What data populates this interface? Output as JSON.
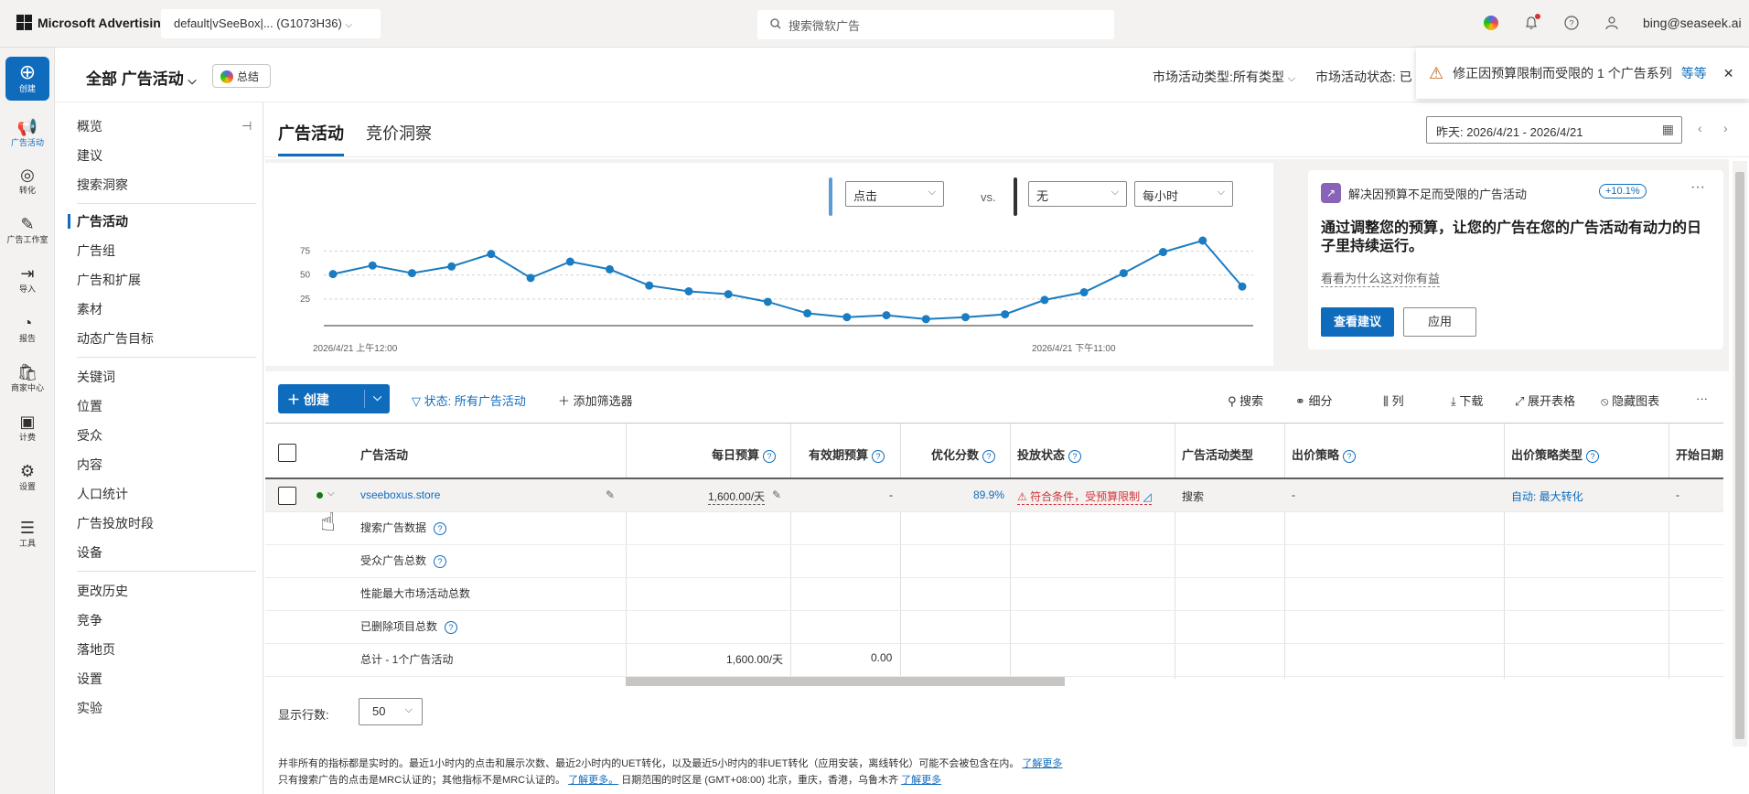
{
  "topbar": {
    "brand": "Microsoft Advertising",
    "account": "default|vSeeBox|...  (G1073H36)",
    "search_placeholder": "搜索微软广告",
    "user_email": "bing@seaseek.ai",
    "icons": [
      "copilot-icon",
      "bell-icon",
      "help-icon",
      "user-icon"
    ]
  },
  "rail": {
    "create": "创建",
    "items": [
      {
        "label": "广告活动",
        "icon": "megaphone-icon"
      },
      {
        "label": "转化",
        "icon": "target-icon"
      },
      {
        "label": "广告工作室",
        "icon": "pen-icon"
      },
      {
        "label": "导入",
        "icon": "import-icon"
      },
      {
        "label": "报告",
        "icon": "chart-icon"
      },
      {
        "label": "商家中心",
        "icon": "bag-icon"
      },
      {
        "label": "计费",
        "icon": "wallet-icon"
      },
      {
        "label": "设置",
        "icon": "gear-icon"
      },
      {
        "label": "工具",
        "icon": "tools-icon"
      }
    ]
  },
  "header": {
    "title": "全部 广告活动",
    "summary_btn": "总结",
    "filter_type": "市场活动类型:所有类型",
    "filter_status": "市场活动状态: 已"
  },
  "notice": {
    "text": "修正因预算限制而受限的 1 个广告系列",
    "more": "等等"
  },
  "subnav": {
    "group1": [
      "概览",
      "建议",
      "搜索洞察"
    ],
    "group2": [
      "广告活动",
      "广告组",
      "广告和扩展",
      "素材",
      "动态广告目标"
    ],
    "group3": [
      "关键词",
      "位置",
      "受众",
      "内容",
      "人口统计",
      "广告投放时段",
      "设备"
    ],
    "group4": [
      "更改历史",
      "竞争",
      "落地页",
      "设置",
      "实验"
    ]
  },
  "tabs": {
    "campaigns": "广告活动",
    "auction": "竞价洞察",
    "date_range": "昨天: 2026/4/21 - 2026/4/21"
  },
  "chart": {
    "metric1": "点击",
    "vs": "vs.",
    "metric2": "无",
    "granularity": "每小时",
    "colors": {
      "line": "#1a7cc1",
      "grid": "#d2d0ce"
    }
  },
  "chart_data": {
    "type": "line",
    "x_start_label": "2026/4/21 上午12:00",
    "x_end_label": "2026/4/21 下午11:00",
    "y_ticks": [
      25,
      50,
      75
    ],
    "ylim": [
      0,
      100
    ],
    "series": [
      {
        "values": [
          51,
          60,
          52,
          59,
          72,
          47,
          64,
          56,
          39,
          33,
          30,
          22,
          10,
          6,
          8,
          4,
          6,
          9,
          24,
          32,
          52,
          74,
          86,
          38
        ]
      }
    ]
  },
  "reco": {
    "head": "解决因预算不足而受限的广告活动",
    "badge": "+10.1%",
    "title": "通过调整您的预算，让您的广告在您的广告活动有动力的日子里持续运行。",
    "why": "看看为什么这对你有益",
    "primary": "查看建议",
    "secondary": "应用"
  },
  "toolbar": {
    "create": "创建",
    "status_filter": "状态: 所有广告活动",
    "add_filter": "添加筛选器",
    "search": "搜索",
    "segment": "细分",
    "columns": "列",
    "download": "下载",
    "expand": "展开表格",
    "hide_chart": "隐藏图表",
    "more": "···"
  },
  "table": {
    "headers": {
      "campaign": "广告活动",
      "daily_budget": "每日预算",
      "lifetime_budget": "有效期预算",
      "opt_score": "优化分数",
      "delivery": "投放状态",
      "campaign_type": "广告活动类型",
      "bid_strategy": "出价策略",
      "bid_strategy_type": "出价策略类型",
      "start_date": "开始日期"
    },
    "row": {
      "campaign": "vseeboxus.store",
      "daily_budget": "1,600.00/天",
      "lifetime_budget": "-",
      "opt_score": "89.9%",
      "delivery": "符合条件，受预算限制",
      "campaign_type": "搜索",
      "bid_strategy": "-",
      "bid_strategy_type": "自动: 最大转化",
      "start_date": "-"
    },
    "summaries": [
      {
        "label": "搜索广告数据",
        "help": true
      },
      {
        "label": "受众广告总数",
        "help": true
      },
      {
        "label": "性能最大市场活动总数",
        "help": false
      },
      {
        "label": "已删除项目总数",
        "help": true
      }
    ],
    "total": {
      "label": "总计 - 1个广告活动",
      "daily_budget": "1,600.00/天",
      "lifetime_budget": "0.00"
    }
  },
  "footer": {
    "rows_label": "显示行数:",
    "rows_value": "50",
    "note1": "并非所有的指标都是实时的。最近1小时内的点击和展示次数、最近2小时内的UET转化，以及最近5小时内的非UET转化（应用安装，离线转化）可能不会被包含在内。",
    "note1_link": "了解更多",
    "note2": "只有搜索广告的点击是MRC认证的；其他指标不是MRC认证的。",
    "note2_link": "了解更多。",
    "note3": "日期范围的时区是 (GMT+08:00) 北京，重庆，香港，乌鲁木齐",
    "note3_link": "了解更多"
  }
}
